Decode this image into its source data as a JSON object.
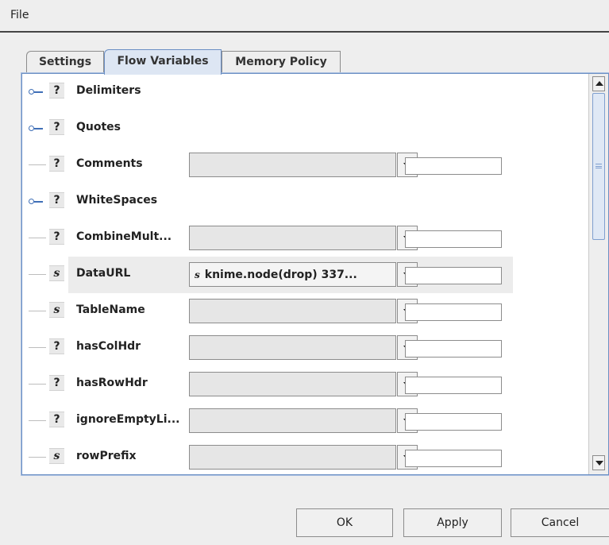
{
  "menubar": {
    "file_label": "File"
  },
  "tabs": [
    {
      "label": "Settings"
    },
    {
      "label": "Flow Variables",
      "active": true
    },
    {
      "label": "Memory Policy"
    }
  ],
  "rows": [
    {
      "label": "Delimiters",
      "type_icon": "?",
      "expandable": true
    },
    {
      "label": "Quotes",
      "type_icon": "?",
      "expandable": true
    },
    {
      "label": "Comments",
      "type_icon": "?",
      "combo_value": "",
      "text_value": ""
    },
    {
      "label": "WhiteSpaces",
      "type_icon": "?",
      "expandable": true
    },
    {
      "label": "CombineMult...",
      "type_icon": "?",
      "combo_value": "",
      "text_value": ""
    },
    {
      "label": "DataURL",
      "type_icon": "s",
      "combo_value": "knime.node(drop) 337...",
      "combo_icon": "s",
      "text_value": "",
      "selected": true
    },
    {
      "label": "TableName",
      "type_icon": "s",
      "combo_value": "",
      "text_value": ""
    },
    {
      "label": "hasColHdr",
      "type_icon": "?",
      "combo_value": "",
      "text_value": ""
    },
    {
      "label": "hasRowHdr",
      "type_icon": "?",
      "combo_value": "",
      "text_value": ""
    },
    {
      "label": "ignoreEmptyLi...",
      "type_icon": "?",
      "combo_value": "",
      "text_value": ""
    },
    {
      "label": "rowPrefix",
      "type_icon": "s",
      "combo_value": "",
      "text_value": ""
    }
  ],
  "buttons": {
    "ok_label": "OK",
    "apply_label": "Apply",
    "cancel_label": "Cancel"
  },
  "colors": {
    "accent": "#6b8fc4",
    "expander": "#3f6fb7",
    "selected_row": "#ececec"
  }
}
